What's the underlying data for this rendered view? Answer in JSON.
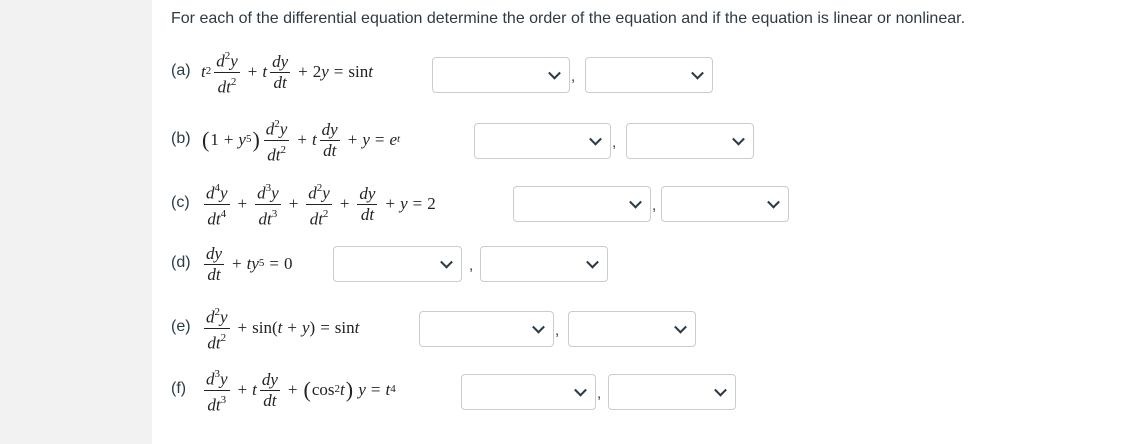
{
  "instructions": "For each of the differential equation determine the order of the equation and if the equation is linear or nonlinear.",
  "separator": ",",
  "problems": [
    {
      "label": "(a)"
    },
    {
      "label": "(b)"
    },
    {
      "label": "(c)"
    },
    {
      "label": "(d)"
    },
    {
      "label": "(e)"
    },
    {
      "label": "(f)"
    }
  ],
  "dropdowns": {
    "order": {
      "selected": ""
    },
    "linearity": {
      "selected": ""
    }
  },
  "icons": {
    "dropdown_arrow": "chevron-down-icon"
  },
  "colors": {
    "text": "#2d3b45",
    "border": "#c7cdd1",
    "background": "#ffffff"
  }
}
